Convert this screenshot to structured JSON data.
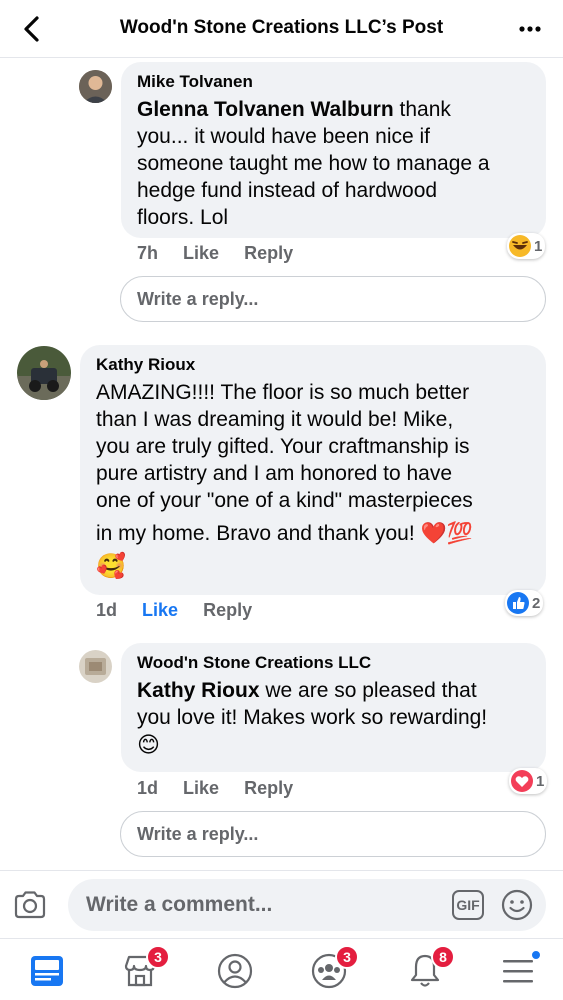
{
  "header": {
    "title": "Wood'n Stone Creations LLC’s Post"
  },
  "comments": [
    {
      "author": "Mike Tolvanen",
      "mention": "Glenna Tolvanen Walburn",
      "lines": [
        " thank",
        "you... it would have been nice if",
        "someone taught me how to manage a",
        "hedge fund instead of hardwood",
        "floors. Lol"
      ],
      "time": "7h",
      "like": "Like",
      "reply": "Reply",
      "reaction": {
        "icon": "haha-icon",
        "count": "1"
      },
      "reply_placeholder": "Write a reply..."
    },
    {
      "author": "Kathy Rioux",
      "lines": [
        "AMAZING!!!! The floor is so much better",
        "than I was dreaming it would be! Mike,",
        "you are truly gifted.  Your craftmanship is",
        "pure artistry and I am honored to have",
        "one of your \"one of a kind\" masterpieces",
        "in my home. Bravo and thank you! ❤️💯",
        "🥰"
      ],
      "time": "1d",
      "like": "Like",
      "reply": "Reply",
      "reaction": {
        "icon": "like-icon",
        "count": "2"
      }
    },
    {
      "author": "Wood'n Stone Creations LLC",
      "mention": "Kathy Rioux",
      "lines": [
        " we are so pleased that",
        "you love it! Makes work so rewarding!",
        "😊"
      ],
      "time": "1d",
      "like": "Like",
      "reply": "Reply",
      "reaction": {
        "icon": "love-icon",
        "count": "1"
      },
      "reply_placeholder": "Write a reply..."
    }
  ],
  "composer": {
    "placeholder": "Write a comment...",
    "gif_label": "GIF"
  },
  "tabbar": {
    "marketplace_badge": "3",
    "groups_badge": "3",
    "notifications_badge": "8"
  },
  "colors": {
    "accent": "#1877f2",
    "badge": "#e41e3f",
    "bubble": "#f0f2f5",
    "muted": "#65676b"
  }
}
